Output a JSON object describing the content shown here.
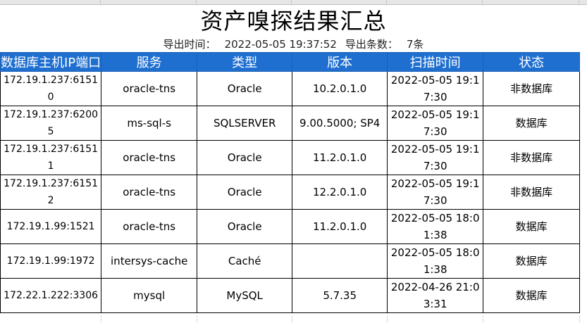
{
  "report": {
    "title": "资产嗅探结果汇总",
    "export_time_label": "导出时间：",
    "export_time_value": "2022-05-05 19:37:52",
    "export_count_label": "导出条数：",
    "export_count_value": "7条"
  },
  "columns": [
    "数据库主机IP端口",
    "服务",
    "类型",
    "版本",
    "扫描时间",
    "状态"
  ],
  "rows": [
    {
      "host": "172.19.1.237:61510",
      "service": "oracle-tns",
      "type": "Oracle",
      "version": "10.2.0.1.0",
      "time": "2022-05-05 19:17:30",
      "status": "非数据库"
    },
    {
      "host": "172.19.1.237:62005",
      "service": "ms-sql-s",
      "type": "SQLSERVER",
      "version": "9.00.5000; SP4",
      "time": "2022-05-05 19:17:30",
      "status": "数据库"
    },
    {
      "host": "172.19.1.237:61511",
      "service": "oracle-tns",
      "type": "Oracle",
      "version": "11.2.0.1.0",
      "time": "2022-05-05 19:17:30",
      "status": "非数据库"
    },
    {
      "host": "172.19.1.237:61512",
      "service": "oracle-tns",
      "type": "Oracle",
      "version": "12.2.0.1.0",
      "time": "2022-05-05 19:17:30",
      "status": "非数据库"
    },
    {
      "host": "172.19.1.99:1521",
      "service": "oracle-tns",
      "type": "Oracle",
      "version": "11.2.0.1.0",
      "time": "2022-05-05 18:01:38",
      "status": "数据库"
    },
    {
      "host": "172.19.1.99:1972",
      "service": "intersys-cache",
      "type": "Caché",
      "version": "",
      "time": "2022-05-05 18:01:38",
      "status": "数据库"
    },
    {
      "host": "172.22.1.222:3306",
      "service": "mysql",
      "type": "MySQL",
      "version": "5.7.35",
      "time": "2022-04-26 21:03:31",
      "status": "数据库"
    }
  ],
  "colors": {
    "header_bg": "#1f6fd0",
    "header_text": "#ffffff",
    "border": "#000000"
  }
}
